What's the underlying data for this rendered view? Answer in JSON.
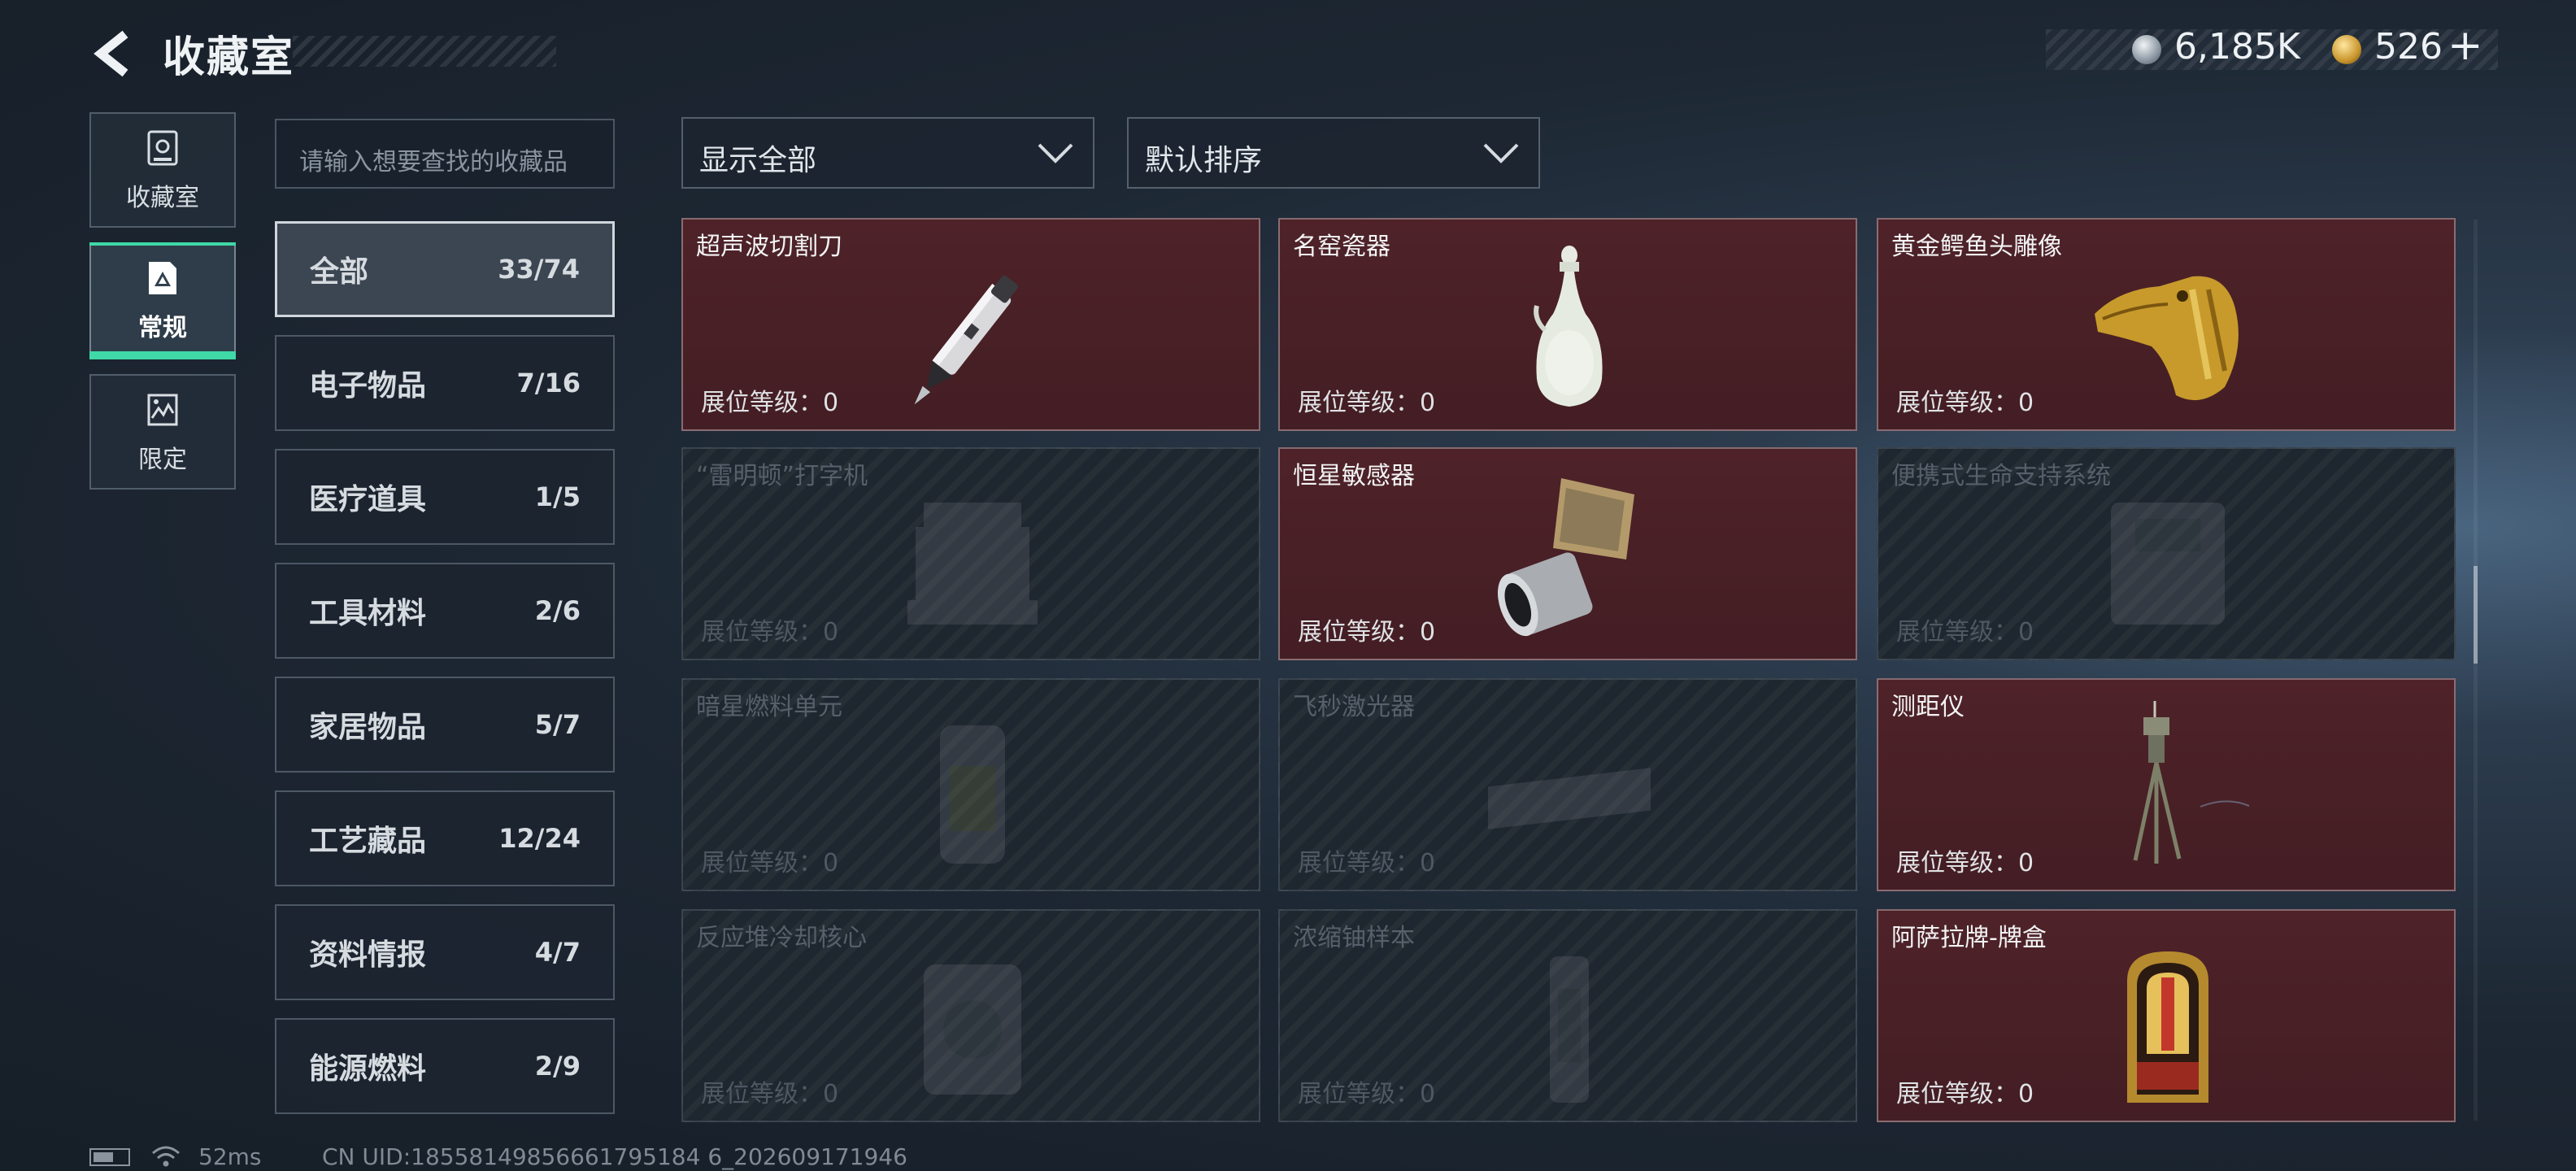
{
  "header": {
    "title": "收藏室"
  },
  "currency": {
    "silver": "6,185K",
    "gold": "526",
    "add_symbol": "+"
  },
  "nav": [
    {
      "label": "收藏室",
      "icon": "vault-icon"
    },
    {
      "label": "常规",
      "icon": "regular-collection-icon",
      "active": true
    },
    {
      "label": "限定",
      "icon": "limited-collection-icon"
    }
  ],
  "search": {
    "placeholder": "请输入想要查找的收藏品"
  },
  "filters": {
    "display": "显示全部",
    "sort": "默认排序"
  },
  "categories": [
    {
      "name": "全部",
      "count": "33/74",
      "active": true
    },
    {
      "name": "电子物品",
      "count": "7/16"
    },
    {
      "name": "医疗道具",
      "count": "1/5"
    },
    {
      "name": "工具材料",
      "count": "2/6"
    },
    {
      "name": "家居物品",
      "count": "5/7"
    },
    {
      "name": "工艺藏品",
      "count": "12/24"
    },
    {
      "name": "资料情报",
      "count": "4/7"
    },
    {
      "name": "能源燃料",
      "count": "2/9"
    }
  ],
  "level_label": "展位等级：0",
  "items": [
    {
      "name": "超声波切割刀",
      "owned": true,
      "icon": "ultrasonic-blade-icon"
    },
    {
      "name": "名窑瓷器",
      "owned": true,
      "icon": "porcelain-vase-icon"
    },
    {
      "name": "黄金鳄鱼头雕像",
      "owned": true,
      "icon": "golden-crocodile-head-icon"
    },
    {
      "name": "“雷明顿”打字机",
      "owned": false,
      "icon": "typewriter-icon"
    },
    {
      "name": "恒星敏感器",
      "owned": true,
      "icon": "star-sensor-icon"
    },
    {
      "name": "便携式生命支持系统",
      "owned": false,
      "icon": "life-support-icon"
    },
    {
      "name": "暗星燃料单元",
      "owned": false,
      "icon": "fuel-cell-icon"
    },
    {
      "name": "飞秒激光器",
      "owned": false,
      "icon": "femtosecond-laser-icon"
    },
    {
      "name": "测距仪",
      "owned": true,
      "icon": "rangefinder-icon"
    },
    {
      "name": "反应堆冷却核心",
      "owned": false,
      "icon": "reactor-core-icon"
    },
    {
      "name": "浓缩铀样本",
      "owned": false,
      "icon": "uranium-sample-icon"
    },
    {
      "name": "阿萨拉牌-牌盒",
      "owned": true,
      "icon": "card-box-icon"
    }
  ],
  "status": {
    "ping": "52ms",
    "uid": "CN UID:18558149856661795184 6_202609171946"
  }
}
